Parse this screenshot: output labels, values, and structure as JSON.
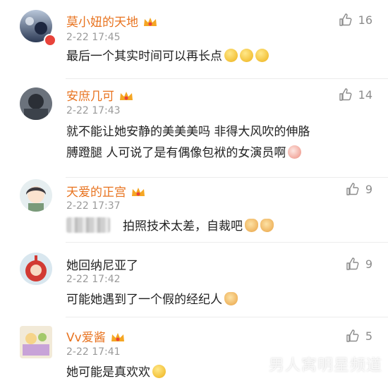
{
  "comments": [
    {
      "username": "莫小妞的天地",
      "time": "2-22 17:45",
      "likes": "16",
      "text": "最后一个其实时间可以再长点",
      "avatar": "night-sky-avatar",
      "emojis": [
        "smile-emoji",
        "smile-emoji",
        "smile-emoji"
      ]
    },
    {
      "username": "安庶几可",
      "time": "2-22 17:43",
      "likes": "14",
      "text_line1": "就不能让她安静的美美美吗 非得大风吹的伸胳",
      "text_line2": "膊蹬腿 人可说了是有偶像包袱的女演员啊",
      "avatar": "dark-photo-avatar",
      "emojis": [
        "shy-emoji"
      ]
    },
    {
      "username": "天爱的正宫",
      "time": "2-22 17:37",
      "likes": "9",
      "text": "拍照技术太差，自裁吧",
      "avatar": "anime-girl-avatar",
      "emojis": [
        "doge-emoji",
        "doge-emoji"
      ]
    },
    {
      "username": "她回纳尼亚了",
      "time": "2-22 17:42",
      "likes": "9",
      "text": "可能她遇到了一个假的经纪人",
      "avatar": "teletubby-avatar",
      "emojis": [
        "doge-emoji"
      ]
    },
    {
      "username": "Vv爱酱",
      "time": "2-22 17:41",
      "likes": "5",
      "text": "她可能是真欢欢",
      "avatar": "cartoon-avatar",
      "emojis": [
        "thinking-emoji"
      ]
    }
  ],
  "watermark": "男人窝明星频道",
  "colors": {
    "username": "#e8731f",
    "time": "#9a9a9a",
    "text": "#222222",
    "like": "#8c8c8c"
  }
}
